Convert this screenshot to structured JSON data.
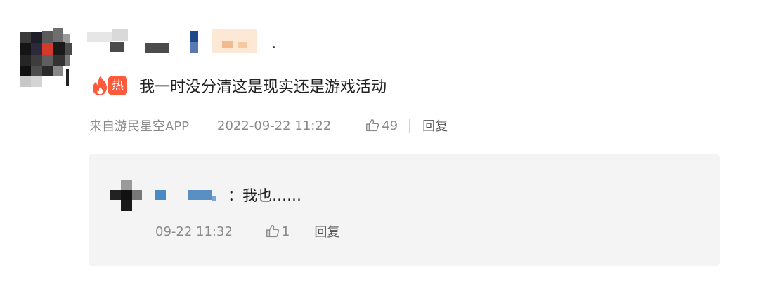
{
  "comment": {
    "hot_badge_label": "热",
    "text": "我一时没分清这是现实还是游戏活动",
    "source": "来自游民星空APP",
    "timestamp": "2022-09-22 11:22",
    "like_count": "49",
    "reply_label": "回复"
  },
  "reply": {
    "separator": "：",
    "text": "我也……",
    "timestamp": "09-22 11:32",
    "like_count": "1",
    "reply_label": "回复"
  },
  "colors": {
    "hot_badge": "#ff5a3c",
    "meta_text": "#8a8a8a",
    "reply_box_bg": "#f4f4f4"
  },
  "icons": {
    "hot": "flame-icon",
    "like": "thumbs-up-icon"
  }
}
